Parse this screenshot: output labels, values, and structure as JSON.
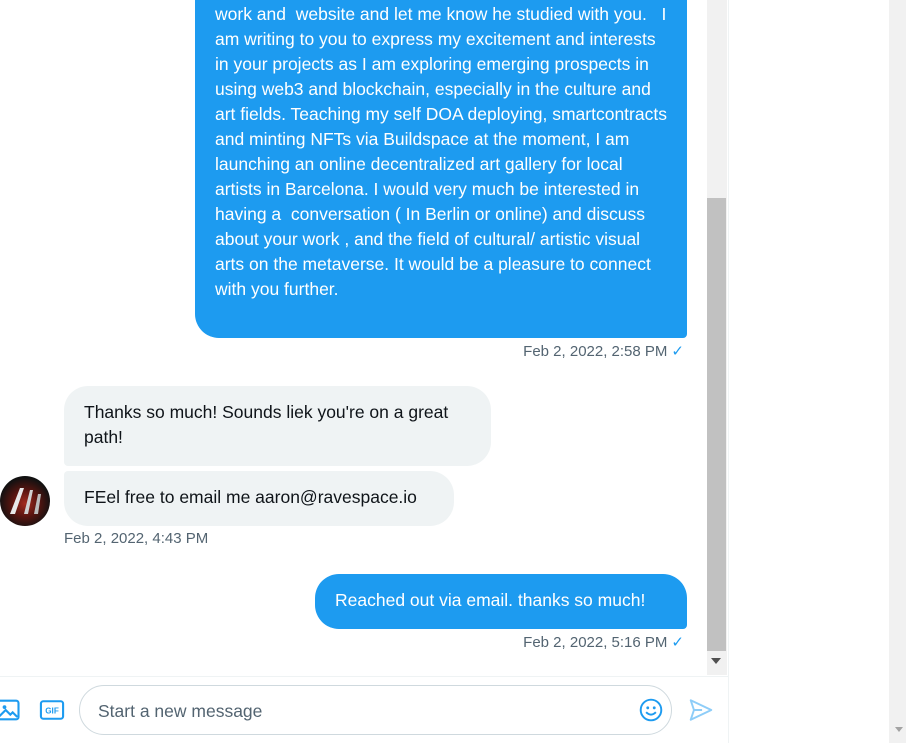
{
  "messages": [
    {
      "direction": "sent",
      "text": "work and  website and let me know he studied with you.   I am writing to you to express my excitement and interests in your projects as I am exploring emerging prospects in using web3 and blockchain, especially in the culture and art fields. Teaching my self DOA deploying, smartcontracts and minting NFTs via Buildspace at the moment, I am launching an online decentralized art gallery for local artists in Barcelona. I would very much be interested in having a  conversation ( In Berlin or online) and discuss about your work , and the field of cultural/ artistic visual arts on the metaverse. It would be a pleasure to connect with you further.",
      "timestamp": "Feb 2, 2022, 2:58 PM"
    },
    {
      "direction": "received",
      "text": "Thanks so much! Sounds liek you're on a great path!"
    },
    {
      "direction": "received",
      "text": "FEel free to email me aaron@ravespace.io",
      "timestamp": "Feb 2, 2022, 4:43 PM"
    },
    {
      "direction": "sent",
      "text": "Reached out via email. thanks so much!",
      "timestamp": "Feb 2, 2022, 5:16 PM"
    }
  ],
  "read_check": "✓",
  "composer": {
    "placeholder": "Start a new message"
  },
  "icons": {
    "media": "image-icon",
    "gif": "gif-icon",
    "emoji": "emoji-icon",
    "send": "send-icon"
  },
  "gif_label": "GIF",
  "colors": {
    "accent": "#1d9bf0",
    "received_bubble": "#eff3f4",
    "muted_text": "#536471"
  }
}
